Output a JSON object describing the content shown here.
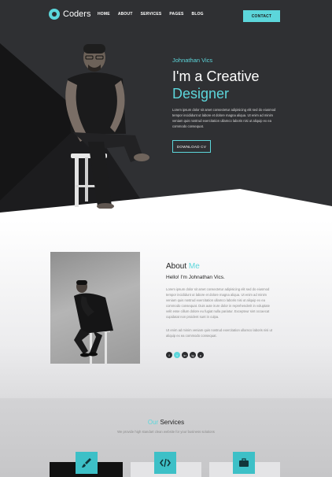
{
  "nav": {
    "brand": "Coders",
    "menu": [
      "HOME",
      "ABOUT",
      "SERVICES",
      "PAGES",
      "BLOG"
    ],
    "contact": "CONTACT"
  },
  "hero": {
    "name": "Johnathan Vics",
    "heading": "I'm a Creative",
    "heading_highlight": "Designer",
    "text": "Lorem ipsum dolor sit amet consectetur adipisicing elit sed do eiusmod tempor incididunt ut labore et dolore magna aliqua. Ut enim ad minim veniam quis nostrud exercitation ullamco laboris nisi ut aliquip ex ea commodo consequat.",
    "download": "DOWNLOAD CV"
  },
  "about": {
    "title": "About",
    "title_highlight": "Me",
    "hello": "Hello! I'm Johnathan Vics.",
    "text": "Lorem ipsum dolor sit amet consectetur adipisicing elit sed do eiusmod tempor incididunt ut labore et dolore magna aliqua. Ut enim ad minim veniam quis nostrud exercitation ullamco laboris nisi ut aliquip ex ea commodo consequat. Duis aute irure dolor in reprehenderit in voluptate velit esse cillum dolore eu fugiat nulla pariatur. Excepteur sint occaecat cupidatat non proident sunt in culpa.",
    "text2": "Ut enim ad minim veniam quis nostrud exercitation ullamco laboris nisi ut aliquip ex ea commodo consequat.",
    "socials": [
      "f",
      "t",
      "in",
      "ig",
      "p"
    ]
  },
  "services": {
    "title": "Our",
    "title_highlight": "Services",
    "subtitle": "We provide high standart clean website for your business solutions",
    "icons": [
      "brush-icon",
      "code-icon",
      "briefcase-icon"
    ]
  },
  "colors": {
    "accent": "#5cd6db",
    "dark": "#2b2c2f"
  }
}
